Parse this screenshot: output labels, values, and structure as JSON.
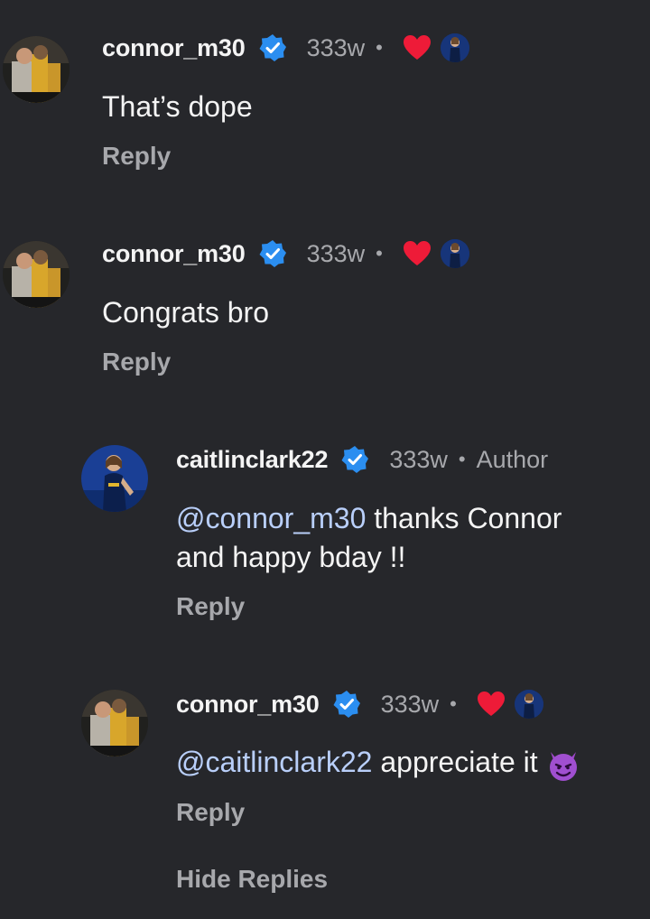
{
  "comments": [
    {
      "username": "connor_m30",
      "time": "333w",
      "dot": "•",
      "text": "That’s dope",
      "reply_label": "Reply",
      "liked_by_author": true,
      "verified": true
    },
    {
      "username": "connor_m30",
      "time": "333w",
      "dot": "•",
      "text": "Congrats bro",
      "reply_label": "Reply",
      "liked_by_author": true,
      "verified": true
    },
    {
      "username": "caitlinclark22",
      "time": "333w",
      "dot": "•",
      "author_label": "Author",
      "mention": "@connor_m30",
      "text_line1": " thanks Connor",
      "text_line2": "and happy bday !!",
      "reply_label": "Reply",
      "verified": true
    },
    {
      "username": "connor_m30",
      "time": "333w",
      "dot": "•",
      "mention": "@caitlinclark22",
      "text": " appreciate it",
      "emoji": "smiling-devil-emoji",
      "reply_label": "Reply",
      "liked_by_author": true,
      "verified": true
    }
  ],
  "hide_replies_label": "Hide Replies",
  "colors": {
    "background": "#26272b",
    "verified_badge": "#2b8ef0",
    "heart": "#ee1b38",
    "mention": "#b9cffa",
    "muted": "#a7a8ac"
  },
  "icons": {
    "verified": "verified-badge-icon",
    "heart": "heart-icon",
    "liker": "author-avatar-mini"
  }
}
